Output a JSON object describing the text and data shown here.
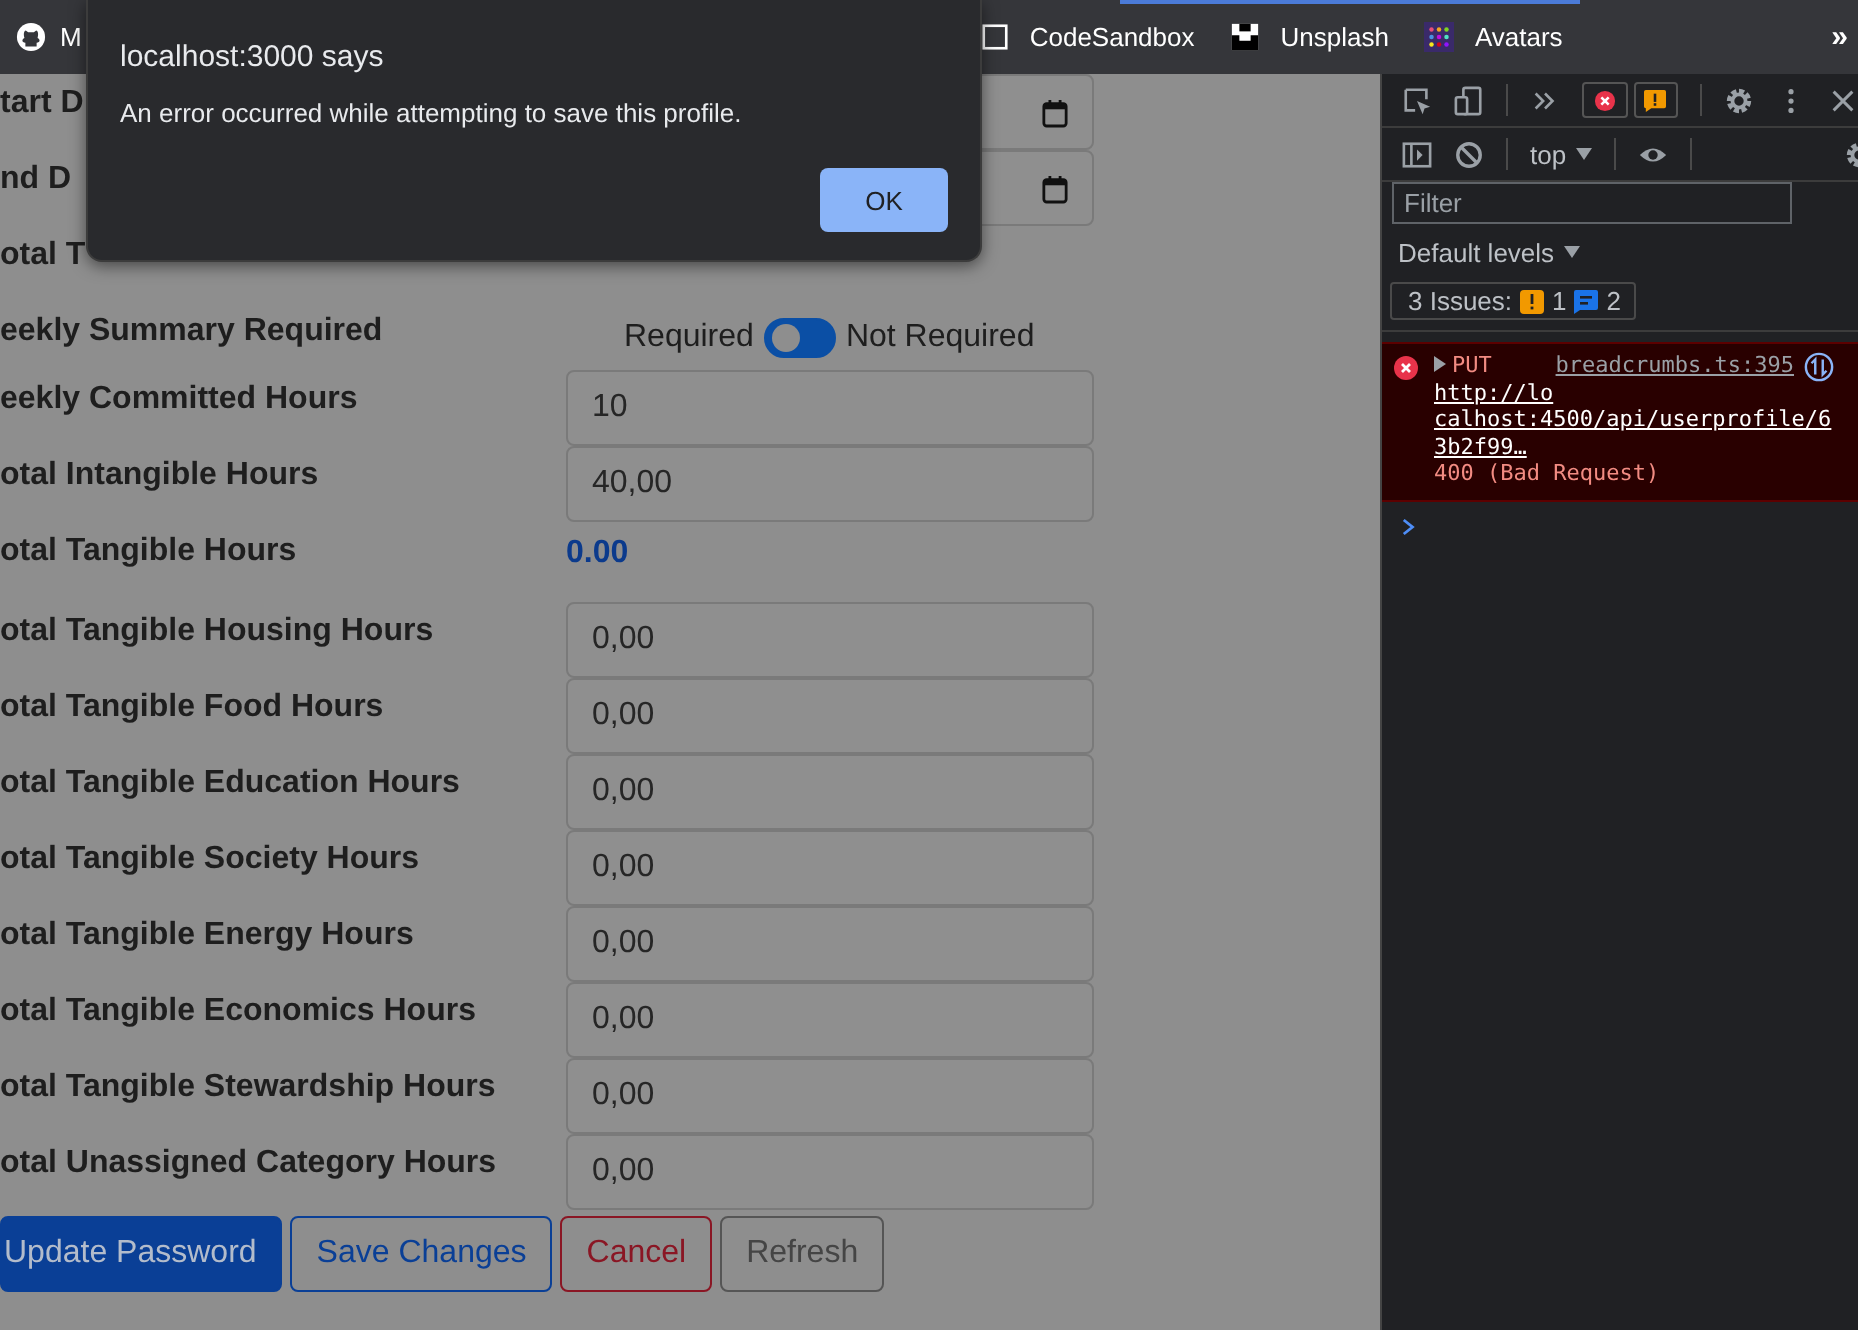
{
  "browser": {
    "bookmarks": [
      {
        "kind": "github",
        "label": "M"
      },
      {
        "kind": "codesandbox",
        "label": "CodeSandbox"
      },
      {
        "kind": "unsplash",
        "label": "Unsplash"
      },
      {
        "kind": "avatars",
        "label": "Avatars"
      }
    ],
    "overflow": "»"
  },
  "form": {
    "rows": [
      {
        "kind": "date",
        "label": "tart D"
      },
      {
        "kind": "date",
        "label": "nd D"
      },
      {
        "kind": "label",
        "label": "otal T"
      },
      {
        "kind": "toggle",
        "label": "eekly Summary Required",
        "off_label": "Required",
        "on_label": "Not Required",
        "checked": false
      },
      {
        "kind": "input",
        "label": "eekly Committed Hours",
        "value": "10"
      },
      {
        "kind": "input",
        "label": "otal Intangible Hours",
        "value": "40,00"
      },
      {
        "kind": "value",
        "label": "otal Tangible Hours",
        "value": "0.00"
      },
      {
        "kind": "input",
        "label": "otal Tangible Housing Hours",
        "value": "0,00"
      },
      {
        "kind": "input",
        "label": "otal Tangible Food Hours",
        "value": "0,00"
      },
      {
        "kind": "input",
        "label": "otal Tangible Education Hours",
        "value": "0,00"
      },
      {
        "kind": "input",
        "label": "otal Tangible Society Hours",
        "value": "0,00"
      },
      {
        "kind": "input",
        "label": "otal Tangible Energy Hours",
        "value": "0,00"
      },
      {
        "kind": "input",
        "label": "otal Tangible Economics Hours",
        "value": "0,00"
      },
      {
        "kind": "input",
        "label": "otal Tangible Stewardship Hours",
        "value": "0,00"
      },
      {
        "kind": "input",
        "label": "otal Unassigned Category Hours",
        "value": "0,00"
      }
    ],
    "buttons": [
      {
        "kind": "primary",
        "label": "Update Password"
      },
      {
        "kind": "outline-primary",
        "label": "Save Changes"
      },
      {
        "kind": "outline-danger",
        "label": "Cancel"
      },
      {
        "kind": "outline-secondary",
        "label": "Refresh"
      }
    ]
  },
  "dialog": {
    "title": "localhost:3000 says",
    "message": "An error occurred while attempting to save this profile.",
    "button": "OK"
  },
  "devtools": {
    "context": "top",
    "filter": {
      "placeholder": "Filter"
    },
    "levels": "Default levels",
    "issues": {
      "label": "3 Issues:",
      "warnings": "1",
      "messages": "2"
    },
    "errors": [
      {
        "method": "PUT",
        "url": "http://localhost:4500/api/userprofile/63b2f99…",
        "status": "400 (Bad Request)",
        "source": "breadcrumbs.ts:395"
      }
    ]
  }
}
